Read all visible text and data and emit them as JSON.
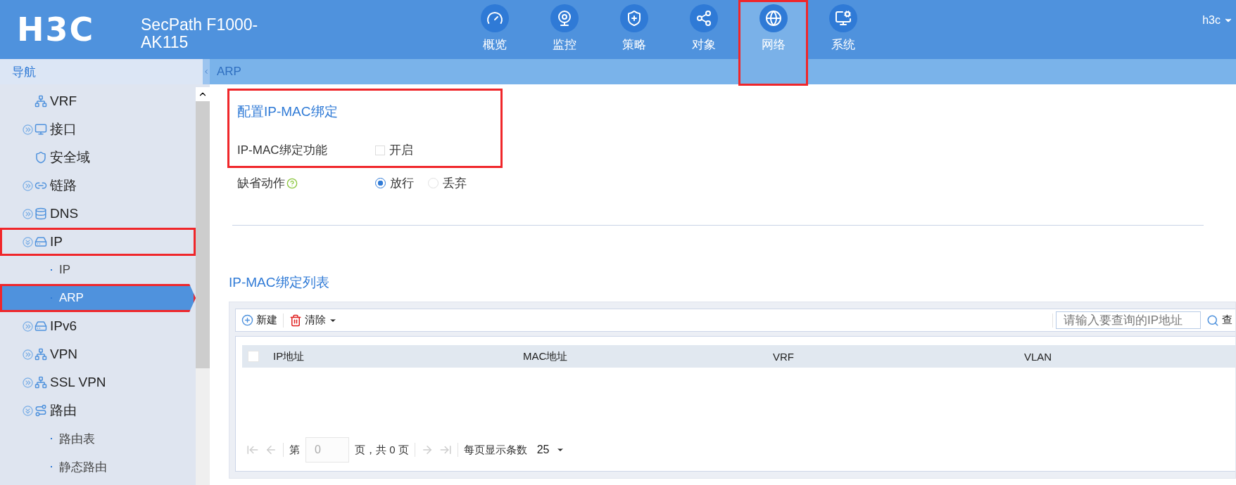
{
  "header": {
    "logo": "H3C",
    "product": "SecPath F1000-\nAK115",
    "user": "h3c",
    "tabs": [
      {
        "label": "概览",
        "selected": false,
        "highlighted": false
      },
      {
        "label": "监控",
        "selected": false,
        "highlighted": false
      },
      {
        "label": "策略",
        "selected": false,
        "highlighted": false
      },
      {
        "label": "对象",
        "selected": false,
        "highlighted": false
      },
      {
        "label": "网络",
        "selected": true,
        "highlighted": true
      },
      {
        "label": "系统",
        "selected": false,
        "highlighted": false
      }
    ]
  },
  "sidebar": {
    "title": "导航",
    "items": [
      {
        "label": "VRF",
        "selected": false,
        "highlighted": false
      },
      {
        "label": "接口",
        "expanded": false,
        "selected": false,
        "highlighted": false
      },
      {
        "label": "安全域",
        "selected": false,
        "highlighted": false
      },
      {
        "label": "链路",
        "expanded": false,
        "selected": false,
        "highlighted": false
      },
      {
        "label": "DNS",
        "expanded": false,
        "selected": false,
        "highlighted": false
      },
      {
        "label": "IP",
        "expanded": true,
        "selected": false,
        "highlighted": true,
        "children": [
          {
            "label": "IP",
            "selected": false,
            "highlighted": false
          },
          {
            "label": "ARP",
            "selected": true,
            "highlighted": true
          }
        ]
      },
      {
        "label": "IPv6",
        "expanded": false,
        "selected": false,
        "highlighted": false
      },
      {
        "label": "VPN",
        "expanded": false,
        "selected": false,
        "highlighted": false
      },
      {
        "label": "SSL VPN",
        "expanded": false,
        "selected": false,
        "highlighted": false
      },
      {
        "label": "路由",
        "expanded": true,
        "selected": false,
        "highlighted": false,
        "children": [
          {
            "label": "路由表",
            "selected": false,
            "highlighted": false
          },
          {
            "label": "静态路由",
            "selected": false,
            "highlighted": false
          }
        ]
      }
    ]
  },
  "breadcrumb": "ARP",
  "config": {
    "title": "配置IP-MAC绑定",
    "highlighted": true,
    "binding": {
      "label": "IP-MAC绑定功能",
      "option": "开启",
      "checked": false
    },
    "default_action": {
      "label": "缺省动作",
      "options": [
        {
          "label": "放行",
          "selected": true
        },
        {
          "label": "丢弃",
          "selected": false
        }
      ]
    }
  },
  "list": {
    "title": "IP-MAC绑定列表",
    "toolbar": {
      "new": "新建",
      "clear": "清除",
      "search_placeholder": "请输入要查询的IP地址",
      "query": "查"
    },
    "select_all": {
      "checked": false
    },
    "columns": [
      "IP地址",
      "MAC地址",
      "VRF",
      "VLAN"
    ],
    "pager": {
      "page_prefix": "第",
      "page": "0",
      "page_suffix": "页，共 0 页",
      "per_page_label": "每页显示条数",
      "per_page": "25"
    }
  }
}
